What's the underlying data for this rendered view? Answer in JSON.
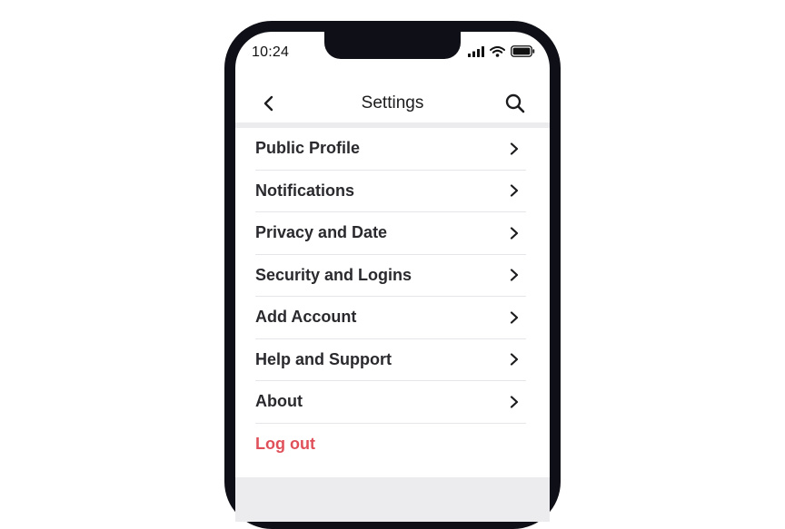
{
  "status_bar": {
    "time": "10:24",
    "icons": [
      "signal-icon",
      "wifi-icon",
      "battery-icon"
    ]
  },
  "header": {
    "title": "Settings",
    "back_icon": "chevron-left-icon",
    "search_icon": "search-icon"
  },
  "menu": {
    "items": [
      {
        "label": "Public Profile"
      },
      {
        "label": "Notifications"
      },
      {
        "label": "Privacy and Date"
      },
      {
        "label": "Security and Logins"
      },
      {
        "label": "Add Account"
      },
      {
        "label": "Help and Support"
      },
      {
        "label": "About"
      }
    ],
    "logout_label": "Log out"
  },
  "colors": {
    "phone_frame": "#0f0f17",
    "logout": "#e0505a",
    "separator_band": "#ececef"
  }
}
